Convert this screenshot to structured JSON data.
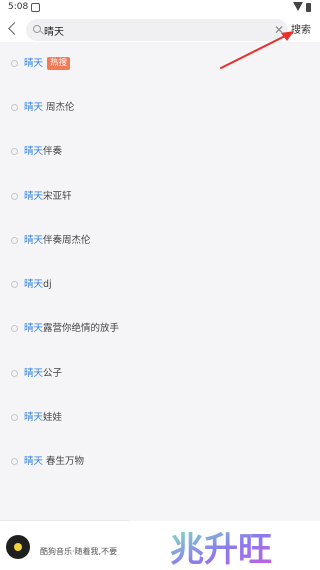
{
  "status_bar": {
    "time": "5:08"
  },
  "search": {
    "value": "晴天",
    "placeholder": "",
    "clear_icon": "close-icon",
    "button_label": "搜索"
  },
  "suggestions": [
    {
      "keyword": "晴天",
      "rest": "",
      "badge": "热搜"
    },
    {
      "keyword": "晴天",
      "rest": " 周杰伦"
    },
    {
      "keyword": "晴天",
      "rest": "伴奏"
    },
    {
      "keyword": "晴天",
      "rest": "宋亚轩"
    },
    {
      "keyword": "晴天",
      "rest": "伴奏周杰伦"
    },
    {
      "keyword": "晴天",
      "rest": "dj"
    },
    {
      "keyword": "晴天",
      "rest": "露营你绝情的放手"
    },
    {
      "keyword": "晴天",
      "rest": "公子"
    },
    {
      "keyword": "晴天",
      "rest": "娃娃"
    },
    {
      "keyword": "晴天",
      "rest": " 春生万物"
    }
  ],
  "mini_player": {
    "text": "酷狗音乐·随着我,不要"
  },
  "watermark": {
    "text": "兆升旺"
  },
  "colors": {
    "keyword": "#2f7fe0",
    "badge": "#f47a55",
    "annotation": "#e8302a"
  }
}
